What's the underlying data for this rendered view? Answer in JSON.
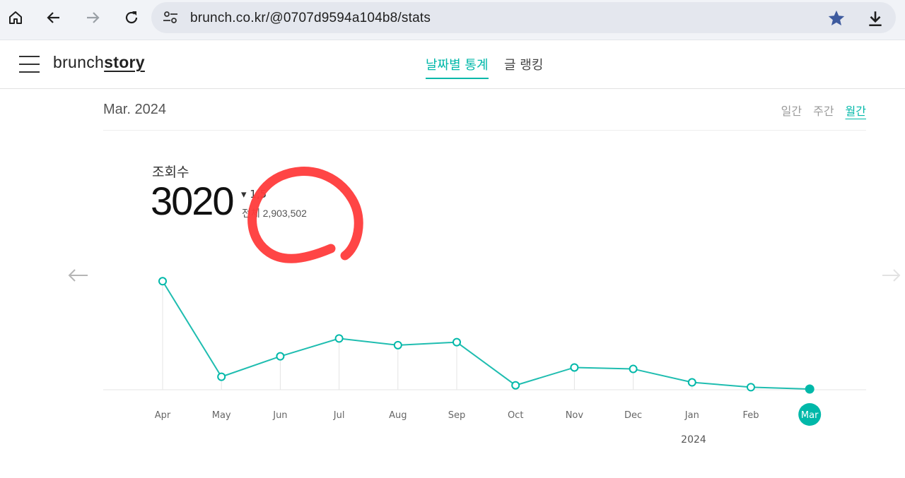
{
  "browser": {
    "url": "brunch.co.kr/@0707d9594a104b8/stats"
  },
  "header": {
    "logo_left": "brunch",
    "logo_right": "story",
    "tabs": [
      {
        "label": "날짜별 통계"
      },
      {
        "label": "글 랭킹"
      }
    ]
  },
  "stats": {
    "period": "Mar. 2024",
    "ranges": [
      "일간",
      "주간",
      "월간"
    ],
    "metric_label": "조회수",
    "metric_value": "3020",
    "change": "▾ 1,5",
    "total": "전체 2,903,502",
    "year_label": "2024"
  },
  "colors": {
    "accent": "#00b8a9",
    "annotation": "#ff3b3b"
  },
  "chart_data": {
    "type": "line",
    "categories": [
      "Apr",
      "May",
      "Jun",
      "Jul",
      "Aug",
      "Sep",
      "Oct",
      "Nov",
      "Dec",
      "Jan",
      "Feb",
      "Mar"
    ],
    "values": [
      29000,
      3300,
      8800,
      13600,
      11800,
      12600,
      1000,
      5800,
      5400,
      1800,
      500,
      0
    ],
    "selected": "Mar",
    "grid": false,
    "ylim": [
      0,
      30000
    ]
  }
}
